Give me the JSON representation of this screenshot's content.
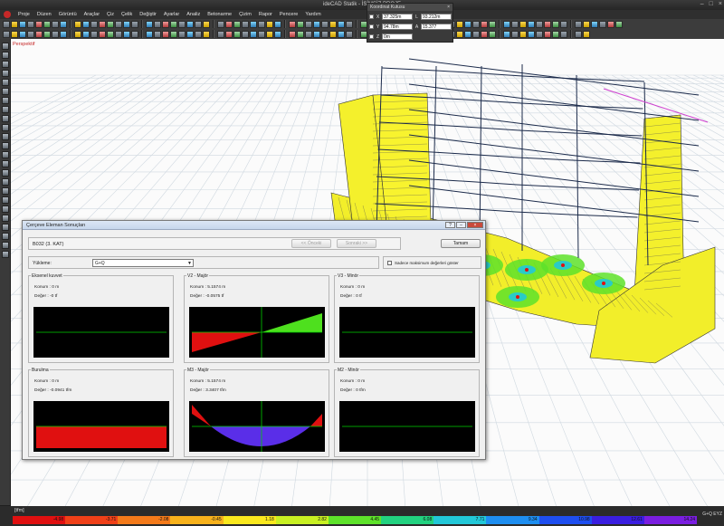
{
  "window": {
    "title": "ideCAD Statik - İSİMSİZ PROJE"
  },
  "menu": [
    "Proje",
    "Düzen",
    "Görüntü",
    "Araçlar",
    "Çiz",
    "Çelik",
    "Değiştir",
    "Ayarlar",
    "Analiz",
    "Betonarme",
    "Çizim",
    "Rapor",
    "Pencere",
    "Yardım"
  ],
  "viewport": {
    "label": "Perspektif"
  },
  "coordbox": {
    "title": "Koordinat Kutusu",
    "x_label": "X",
    "x_value": "37.325m",
    "y_label": "Y",
    "y_value": "94.78m",
    "z_label": "Z",
    "z_value": "0m",
    "l_label": "L",
    "l_value": "93.212m",
    "a_label": "A",
    "a_value": "15.377"
  },
  "dialog": {
    "title": "Çerçeve Eleman Sonuçları",
    "element": "B032 (3. KAT)",
    "prev_label": "<< Önceki",
    "next_label": "Sonraki >>",
    "ok_label": "Tamam",
    "load_label": "Yükleme:",
    "load_value": "G+Q",
    "max_label": "Sadece maksimum değerleri göster",
    "panels": [
      {
        "title": "Eksenel kuvvet",
        "loc": "Konum : 0 m",
        "val": "Değer : -0 tf",
        "shape": "flat"
      },
      {
        "title": "V2 - Majör",
        "loc": "Konum : 5.1574 m",
        "val": "Değer : -0.0575 tf",
        "shape": "linear"
      },
      {
        "title": "V3 - Minör",
        "loc": "Konum : 0 m",
        "val": "Değer : 0 tf",
        "shape": "flat"
      },
      {
        "title": "Burulma",
        "loc": "Konum : 0 m",
        "val": "Değer : -0.0941 tfm",
        "shape": "rect"
      },
      {
        "title": "M3 - Majör",
        "loc": "Konum : 5.1574 m",
        "val": "Değer : 3.3407 tfm",
        "shape": "parabola"
      },
      {
        "title": "M2 - Minör",
        "loc": "Konum : 0 m",
        "val": "Değer : 0 tfm",
        "shape": "flat"
      }
    ]
  },
  "legend": {
    "unit": "[tfm]",
    "camera": "G+Q EYZ",
    "values": [
      "-4.98",
      "-3.71",
      "-2.08",
      "-0.45",
      "1.18",
      "2.82",
      "4.45",
      "6.08",
      "7.71",
      "9.34",
      "10.98",
      "12.61",
      "14.24"
    ],
    "colors": [
      "#e01010",
      "#f04018",
      "#f47a1a",
      "#f8b21c",
      "#fae81e",
      "#c8f022",
      "#5ee22a",
      "#22d280",
      "#22c8d8",
      "#1e8ef0",
      "#1e4ef0",
      "#3a1ee0",
      "#7a1ee0"
    ]
  },
  "colors": {
    "shear": [
      "#e01010",
      "#4ee01e"
    ],
    "moment_pos": "#5a2ee8",
    "moment_neg": "#e01010",
    "axis": "#00d000",
    "diagram_bg": "#000000"
  }
}
